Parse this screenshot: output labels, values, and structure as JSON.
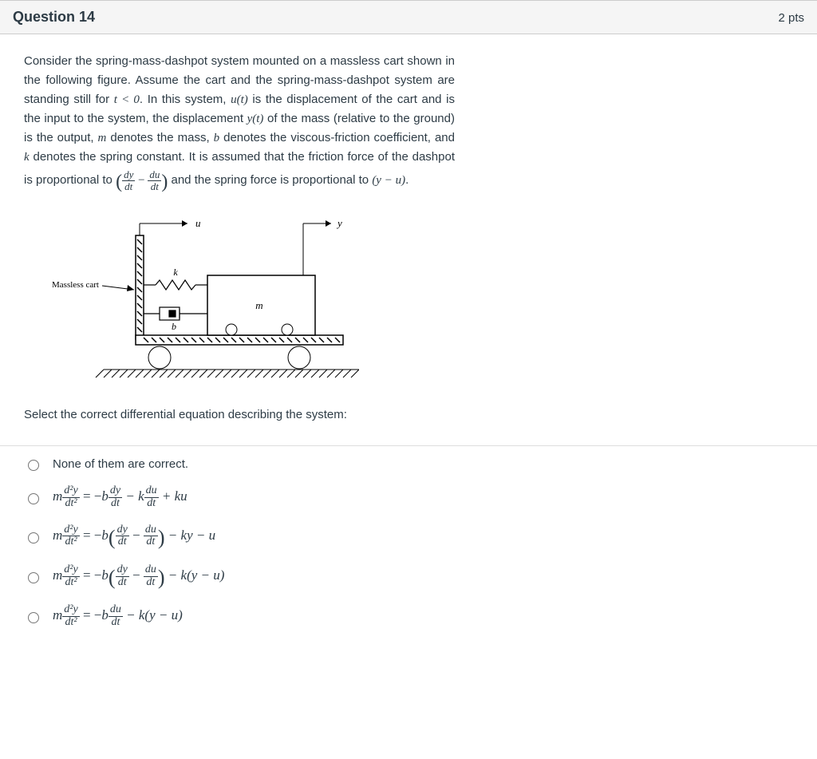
{
  "header": {
    "title": "Question 14",
    "points": "2 pts"
  },
  "question": {
    "text_parts": {
      "p1": "Consider the spring-mass-dashpot system mounted on a massless cart shown in the following figure. Assume the cart and the spring-mass-dashpot system are standing still for ",
      "tlt": "t < 0",
      "p2": ". In this system, ",
      "ut": "u(t)",
      "p3": " is the displacement of the cart and is the input to the system, the displacement ",
      "yt": "y(t)",
      "p4": " of the mass (relative to the ground) is the output, ",
      "m": "m",
      "p5": " denotes the mass, ",
      "b": "b",
      "p6": " denotes the viscous-friction coefficient, and ",
      "k": "k",
      "p7": " denotes the spring constant. It is assumed that the friction force of the dashpot is proportional to ",
      "p8": " and the spring force is proportional to ",
      "yu": "(y − u)",
      "p9": "."
    },
    "frac1": {
      "num1": "dy",
      "den1": "dt",
      "minus": " − ",
      "num2": "du",
      "den2": "dt"
    }
  },
  "figure": {
    "massless_cart": "Massless cart",
    "u": "u",
    "y": "y",
    "k": "k",
    "b": "b",
    "m": "m"
  },
  "prompt2": "Select the correct differential equation describing the system:",
  "options": {
    "a": {
      "text": "None of them are correct."
    },
    "b": {
      "lhs_m": "m",
      "d2y": "d²y",
      "dt2": "dt²",
      "eq": " = −",
      "b": "b",
      "dy": "dy",
      "dt": "dt",
      "mk": " − k",
      "du": "du",
      "plus": " + ku"
    },
    "c": {
      "lhs_m": "m",
      "d2y": "d²y",
      "dt2": "dt²",
      "eq": " = −",
      "b": "b",
      "dy": "dy",
      "dt": "dt",
      "minus": " − ",
      "du": "du",
      "tail": " − ky − u"
    },
    "d": {
      "lhs_m": "m",
      "d2y": "d²y",
      "dt2": "dt²",
      "eq": " = −",
      "b": "b",
      "dy": "dy",
      "dt": "dt",
      "minus": " − ",
      "du": "du",
      "tail": " − k(y − u)"
    },
    "e": {
      "lhs_m": "m",
      "d2y": "d²y",
      "dt2": "dt²",
      "eq": " = −",
      "b": "b",
      "du": "du",
      "dt": "dt",
      "tail": " − k(y − u)"
    }
  }
}
